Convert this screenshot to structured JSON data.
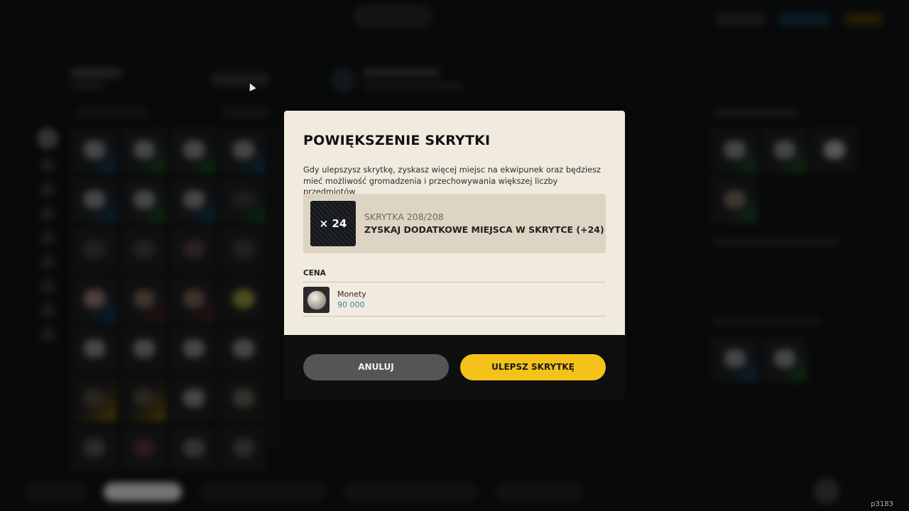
{
  "modal": {
    "title": "POWIĘKSZENIE SKRYTKI",
    "description": "Gdy ulepszysz skrytkę, zyskasz więcej miejsc na ekwipunek oraz będziesz mieć możliwość gromadzenia i przechowywania większej liczby przedmiotów",
    "upgrade": {
      "icon_label": "× 24",
      "stash_label": "SKRYTKA",
      "stash_count": "208/208",
      "benefit": "ZYSKAJ DODATKOWE MIEJSCA W SKRYTCE (+24)"
    },
    "price_label": "CENA",
    "currency": {
      "name": "Monety",
      "amount": "90 000",
      "icon": "coin-icon"
    },
    "cancel_label": "ANULUJ",
    "confirm_label": "ULEPSZ SKRYTKĘ"
  },
  "watermark": "p3183",
  "colors": {
    "modal_bg": "#f1ebdf",
    "confirm": "#f5c21a",
    "cancel": "#555555",
    "currency_value": "#2f8a9c"
  }
}
